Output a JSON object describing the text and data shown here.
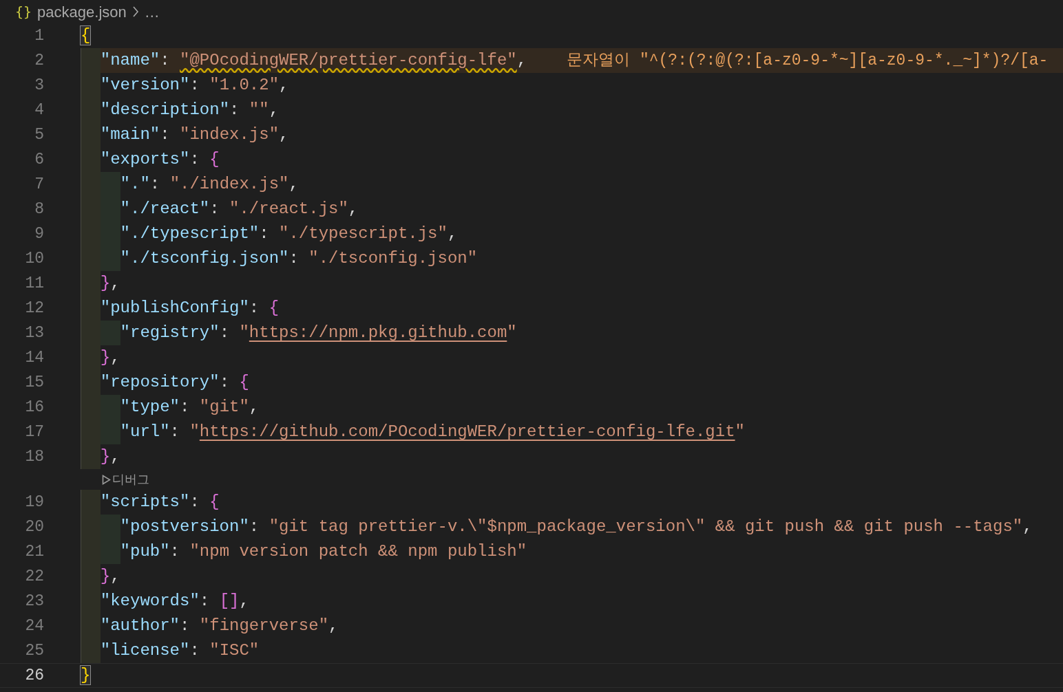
{
  "breadcrumb": {
    "file_icon": "{}",
    "file": "package.json",
    "more": "…"
  },
  "lines": [
    {
      "number": "1",
      "tokens": [
        {
          "kind": "outer",
          "text": "{",
          "matched": true
        }
      ]
    },
    {
      "number": "2",
      "guides": [
        {
          "kind": "outer"
        }
      ],
      "message": "문자열이 \"^(?:(?:@(?:[a-z0-9-*~][a-z0-9-*._~]*)?/[a-",
      "tokens": [
        {
          "kind": "key",
          "text": "\"name\""
        },
        {
          "kind": "punct",
          "text": ": "
        },
        {
          "kind": "string",
          "text": "\"@POcodingWER/prettier-config-lfe\"",
          "squiggle": true
        },
        {
          "kind": "punct",
          "text": ","
        }
      ]
    },
    {
      "number": "3",
      "guides": [
        {
          "kind": "outer"
        }
      ],
      "tokens": [
        {
          "kind": "key",
          "text": "\"version\""
        },
        {
          "kind": "punct",
          "text": ": "
        },
        {
          "kind": "string",
          "text": "\"1.0.2\""
        },
        {
          "kind": "punct",
          "text": ","
        }
      ]
    },
    {
      "number": "4",
      "guides": [
        {
          "kind": "outer"
        }
      ],
      "tokens": [
        {
          "kind": "key",
          "text": "\"description\""
        },
        {
          "kind": "punct",
          "text": ": "
        },
        {
          "kind": "string",
          "text": "\"\""
        },
        {
          "kind": "punct",
          "text": ","
        }
      ]
    },
    {
      "number": "5",
      "guides": [
        {
          "kind": "outer"
        }
      ],
      "tokens": [
        {
          "kind": "key",
          "text": "\"main\""
        },
        {
          "kind": "punct",
          "text": ": "
        },
        {
          "kind": "string",
          "text": "\"index.js\""
        },
        {
          "kind": "punct",
          "text": ","
        }
      ]
    },
    {
      "number": "6",
      "guides": [
        {
          "kind": "outer"
        }
      ],
      "tokens": [
        {
          "kind": "key",
          "text": "\"exports\""
        },
        {
          "kind": "punct",
          "text": ": "
        },
        {
          "kind": "inner",
          "text": "{"
        }
      ]
    },
    {
      "number": "7",
      "guides": [
        {
          "kind": "outer"
        },
        {
          "kind": "inner"
        }
      ],
      "tokens": [
        {
          "kind": "key",
          "text": "\".\""
        },
        {
          "kind": "punct",
          "text": ": "
        },
        {
          "kind": "string",
          "text": "\"./index.js\""
        },
        {
          "kind": "punct",
          "text": ","
        }
      ]
    },
    {
      "number": "8",
      "guides": [
        {
          "kind": "outer"
        },
        {
          "kind": "inner"
        }
      ],
      "tokens": [
        {
          "kind": "key",
          "text": "\"./react\""
        },
        {
          "kind": "punct",
          "text": ": "
        },
        {
          "kind": "string",
          "text": "\"./react.js\""
        },
        {
          "kind": "punct",
          "text": ","
        }
      ]
    },
    {
      "number": "9",
      "guides": [
        {
          "kind": "outer"
        },
        {
          "kind": "inner"
        }
      ],
      "tokens": [
        {
          "kind": "key",
          "text": "\"./typescript\""
        },
        {
          "kind": "punct",
          "text": ": "
        },
        {
          "kind": "string",
          "text": "\"./typescript.js\""
        },
        {
          "kind": "punct",
          "text": ","
        }
      ]
    },
    {
      "number": "10",
      "guides": [
        {
          "kind": "outer"
        },
        {
          "kind": "inner"
        }
      ],
      "tokens": [
        {
          "kind": "key",
          "text": "\"./tsconfig.json\""
        },
        {
          "kind": "punct",
          "text": ": "
        },
        {
          "kind": "string",
          "text": "\"./tsconfig.json\""
        }
      ]
    },
    {
      "number": "11",
      "guides": [
        {
          "kind": "outer"
        }
      ],
      "tokens": [
        {
          "kind": "inner",
          "text": "}"
        },
        {
          "kind": "punct",
          "text": ","
        }
      ]
    },
    {
      "number": "12",
      "guides": [
        {
          "kind": "outer"
        }
      ],
      "tokens": [
        {
          "kind": "key",
          "text": "\"publishConfig\""
        },
        {
          "kind": "punct",
          "text": ": "
        },
        {
          "kind": "inner",
          "text": "{"
        }
      ]
    },
    {
      "number": "13",
      "guides": [
        {
          "kind": "outer"
        },
        {
          "kind": "inner"
        }
      ],
      "tokens": [
        {
          "kind": "key",
          "text": "\"registry\""
        },
        {
          "kind": "punct",
          "text": ": "
        },
        {
          "kind": "string",
          "text": "\""
        },
        {
          "kind": "link",
          "text": "https://npm.pkg.github.com"
        },
        {
          "kind": "string",
          "text": "\""
        }
      ]
    },
    {
      "number": "14",
      "guides": [
        {
          "kind": "outer"
        }
      ],
      "tokens": [
        {
          "kind": "inner",
          "text": "}"
        },
        {
          "kind": "punct",
          "text": ","
        }
      ]
    },
    {
      "number": "15",
      "guides": [
        {
          "kind": "outer"
        }
      ],
      "tokens": [
        {
          "kind": "key",
          "text": "\"repository\""
        },
        {
          "kind": "punct",
          "text": ": "
        },
        {
          "kind": "inner",
          "text": "{"
        }
      ]
    },
    {
      "number": "16",
      "guides": [
        {
          "kind": "outer"
        },
        {
          "kind": "inner"
        }
      ],
      "tokens": [
        {
          "kind": "key",
          "text": "\"type\""
        },
        {
          "kind": "punct",
          "text": ": "
        },
        {
          "kind": "string",
          "text": "\"git\""
        },
        {
          "kind": "punct",
          "text": ","
        }
      ]
    },
    {
      "number": "17",
      "guides": [
        {
          "kind": "outer"
        },
        {
          "kind": "inner"
        }
      ],
      "tokens": [
        {
          "kind": "key",
          "text": "\"url\""
        },
        {
          "kind": "punct",
          "text": ": "
        },
        {
          "kind": "string",
          "text": "\""
        },
        {
          "kind": "link",
          "text": "https://github.com/POcodingWER/prettier-config-lfe.git"
        },
        {
          "kind": "string",
          "text": "\""
        }
      ]
    },
    {
      "number": "18",
      "guides": [
        {
          "kind": "outer"
        }
      ],
      "tokens": [
        {
          "kind": "inner",
          "text": "}"
        },
        {
          "kind": "punct",
          "text": ","
        }
      ]
    },
    {
      "number": "19",
      "guides": [
        {
          "kind": "outer"
        }
      ],
      "codelens": "디버그",
      "tokens": [
        {
          "kind": "key",
          "text": "\"scripts\""
        },
        {
          "kind": "punct",
          "text": ": "
        },
        {
          "kind": "inner",
          "text": "{"
        }
      ]
    },
    {
      "number": "20",
      "guides": [
        {
          "kind": "outer"
        },
        {
          "kind": "inner"
        }
      ],
      "tokens": [
        {
          "kind": "key",
          "text": "\"postversion\""
        },
        {
          "kind": "punct",
          "text": ": "
        },
        {
          "kind": "string",
          "text": "\"git tag prettier-v.\\\"$npm_package_version\\\" && git push && git push --tags\""
        },
        {
          "kind": "punct",
          "text": ","
        }
      ]
    },
    {
      "number": "21",
      "guides": [
        {
          "kind": "outer"
        },
        {
          "kind": "inner"
        }
      ],
      "tokens": [
        {
          "kind": "key",
          "text": "\"pub\""
        },
        {
          "kind": "punct",
          "text": ": "
        },
        {
          "kind": "string",
          "text": "\"npm version patch && npm publish\""
        }
      ]
    },
    {
      "number": "22",
      "guides": [
        {
          "kind": "outer"
        }
      ],
      "tokens": [
        {
          "kind": "inner",
          "text": "}"
        },
        {
          "kind": "punct",
          "text": ","
        }
      ]
    },
    {
      "number": "23",
      "guides": [
        {
          "kind": "outer"
        }
      ],
      "tokens": [
        {
          "kind": "key",
          "text": "\"keywords\""
        },
        {
          "kind": "punct",
          "text": ": "
        },
        {
          "kind": "inner",
          "text": "[]"
        },
        {
          "kind": "punct",
          "text": ","
        }
      ]
    },
    {
      "number": "24",
      "guides": [
        {
          "kind": "outer"
        }
      ],
      "tokens": [
        {
          "kind": "key",
          "text": "\"author\""
        },
        {
          "kind": "punct",
          "text": ": "
        },
        {
          "kind": "string",
          "text": "\"fingerverse\""
        },
        {
          "kind": "punct",
          "text": ","
        }
      ]
    },
    {
      "number": "25",
      "guides": [
        {
          "kind": "outer"
        }
      ],
      "tokens": [
        {
          "kind": "key",
          "text": "\"license\""
        },
        {
          "kind": "punct",
          "text": ": "
        },
        {
          "kind": "string",
          "text": "\"ISC\""
        }
      ]
    },
    {
      "number": "26",
      "active": true,
      "tokens": [
        {
          "kind": "outer",
          "text": "}",
          "matched": true
        }
      ]
    }
  ]
}
